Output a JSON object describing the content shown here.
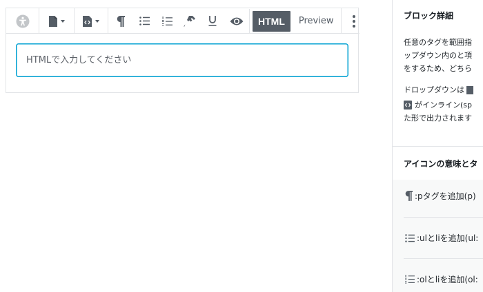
{
  "editor": {
    "toolbar": {
      "html_label": "HTML",
      "preview_label": "Preview"
    },
    "input": {
      "placeholder": "HTMLで入力してください",
      "value": ""
    }
  },
  "sidebar": {
    "block_details": {
      "title": "ブロック詳細",
      "lines": [
        "任意のタグを範囲指",
        "ップダウン内のと項",
        "をするため、どちら"
      ],
      "dropdown_line_1": "ドロップダウンは",
      "dropdown_line_2": "がインライン(sp",
      "dropdown_line_3": "た形で出力されます"
    },
    "icon_panel": {
      "title": "アイコンの意味とタ",
      "items": [
        {
          "icon": "pilcrow-icon",
          "text": ":pタグを追加(p)"
        },
        {
          "icon": "unordered-list-icon",
          "text": ":ulとliを追加(ul:"
        },
        {
          "icon": "ordered-list-icon",
          "text": ":olとliを追加(ol:"
        }
      ]
    }
  },
  "colors": {
    "accent": "#00a0d2",
    "toolbar_icon": "#555d66",
    "border": "#e2e4e7",
    "panel_bg": "#f8f9f9"
  }
}
